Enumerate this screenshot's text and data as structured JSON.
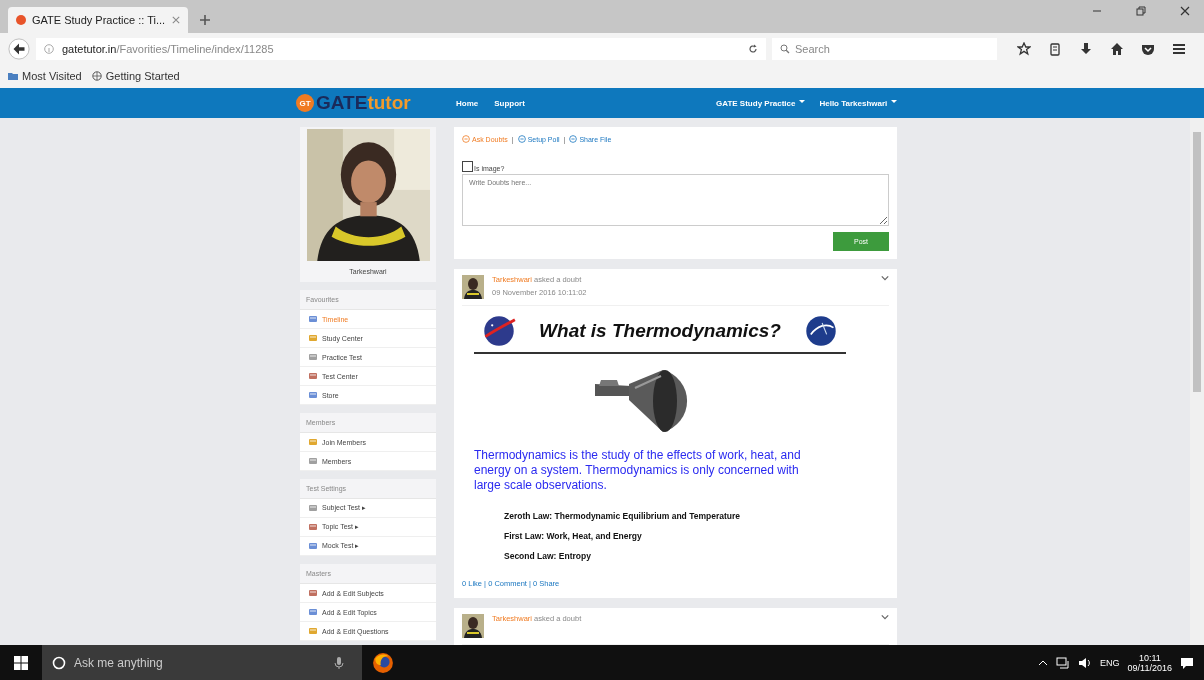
{
  "browser": {
    "tab_title": "GATE Study Practice :: Ti...",
    "url_host": "gatetutor.in",
    "url_path": "/Favorities/Timeline/index/11285",
    "search_placeholder": "Search",
    "bookmarks": [
      "Most Visited",
      "Getting Started"
    ]
  },
  "site": {
    "logo_main": "GATE",
    "logo_accent": "tutor",
    "logo_badge": "GT",
    "nav_left": [
      "Home",
      "Support"
    ],
    "nav_right": [
      "GATE Study Practice",
      "Hello Tarkeshwari"
    ]
  },
  "profile": {
    "name": "Tarkeshwari"
  },
  "sidebar": [
    {
      "title": "Favourites",
      "items": [
        {
          "label": "Timeline",
          "selected": true
        },
        {
          "label": "Study Center",
          "selected": false
        },
        {
          "label": "Practice Test",
          "selected": false
        },
        {
          "label": "Test Center",
          "selected": false
        },
        {
          "label": "Store",
          "selected": false
        }
      ]
    },
    {
      "title": "Members",
      "items": [
        {
          "label": "Join Members",
          "selected": false
        },
        {
          "label": "Members",
          "selected": false
        }
      ]
    },
    {
      "title": "Test Settings",
      "items": [
        {
          "label": "Subject Test ▸",
          "selected": false
        },
        {
          "label": "Topic Test ▸",
          "selected": false
        },
        {
          "label": "Mock Test ▸",
          "selected": false
        }
      ]
    },
    {
      "title": "Masters",
      "items": [
        {
          "label": "Add & Edit Subjects",
          "selected": false
        },
        {
          "label": "Add & Edit Topics",
          "selected": false
        },
        {
          "label": "Add & Edit Questions",
          "selected": false
        }
      ]
    }
  ],
  "composer": {
    "separator": "|",
    "actions": [
      {
        "label": "Ask Doubts",
        "selected": true
      },
      {
        "label": "Setup Poll",
        "selected": false
      },
      {
        "label": "Share File",
        "selected": false
      }
    ],
    "checkbox": {
      "label": "Is image?",
      "checked": false
    },
    "placeholder": "Write Doubts here...",
    "post_button": "Post"
  },
  "posts": [
    {
      "author": "Tarkeshwari",
      "action": "asked a doubt",
      "date": "09 November 2016 10:11:02",
      "slide": {
        "title": "What is Thermodynamics?",
        "body": "Thermodynamics is the study of the effects of work, heat, and energy on a system. Thermodynamics is only concerned with large scale observations.",
        "laws": [
          "Zeroth Law: Thermodynamic Equilibrium and Temperature",
          "First Law: Work, Heat, and Energy",
          "Second Law: Entropy"
        ]
      },
      "footer": "0 Like | 0 Comment | 0 Share"
    },
    {
      "author": "Tarkeshwari",
      "action": "asked a doubt"
    }
  ],
  "taskbar": {
    "search_placeholder": "Ask me anything",
    "language": "ENG",
    "time": "10:11",
    "date": "09/11/2016"
  }
}
